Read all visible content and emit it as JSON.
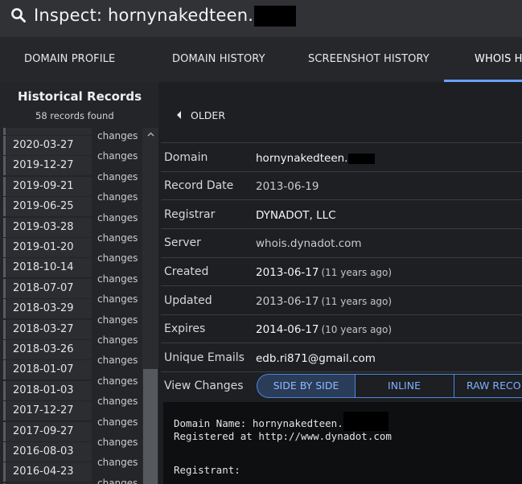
{
  "header": {
    "search_icon": "search-icon",
    "title": "Inspect: hornynakedteen."
  },
  "tabs": [
    {
      "label": "DOMAIN PROFILE"
    },
    {
      "label": "DOMAIN HISTORY"
    },
    {
      "label": "SCREENSHOT HISTORY"
    },
    {
      "label": "WHOIS H"
    }
  ],
  "sidebar": {
    "title": "Historical Records",
    "count": "58 records found",
    "dates": [
      "2020-03-27",
      "2019-12-27",
      "2019-09-21",
      "2019-06-25",
      "2019-03-28",
      "2019-01-20",
      "2018-10-14",
      "2018-07-07",
      "2018-03-29",
      "2018-03-27",
      "2018-03-26",
      "2018-01-07",
      "2018-01-03",
      "2017-12-27",
      "2017-09-27",
      "2016-08-03",
      "2016-04-23"
    ],
    "changes_label": "changes"
  },
  "older_label": "OLDER",
  "record": {
    "domain": {
      "label": "Domain",
      "value": "hornynakedteen."
    },
    "record_date": {
      "label": "Record Date",
      "value": "2013-06-19"
    },
    "registrar": {
      "label": "Registrar",
      "value": "DYNADOT, LLC"
    },
    "server": {
      "label": "Server",
      "value": "whois.dynadot.com"
    },
    "created": {
      "label": "Created",
      "value": "2013-06-17",
      "note": "(11 years ago)"
    },
    "updated": {
      "label": "Updated",
      "value": "2013-06-17",
      "note": "(11 years ago)"
    },
    "expires": {
      "label": "Expires",
      "value": "2014-06-17",
      "note": "(10 years ago)"
    },
    "unique_emails": {
      "label": "Unique Emails",
      "value": "edb.ri871@gmail.com"
    }
  },
  "view_changes": {
    "label": "View Changes",
    "options": [
      "SIDE BY SIDE",
      "INLINE",
      "RAW RECO"
    ],
    "selected": "SIDE BY SIDE"
  },
  "raw_record": {
    "line1": "Domain Name: hornynakedteen.",
    "line2": "Registered at http://www.dynadot.com",
    "line3": "Registrant:"
  },
  "colors": {
    "accent": "#6aa0ff",
    "background": "#1d1f23"
  }
}
